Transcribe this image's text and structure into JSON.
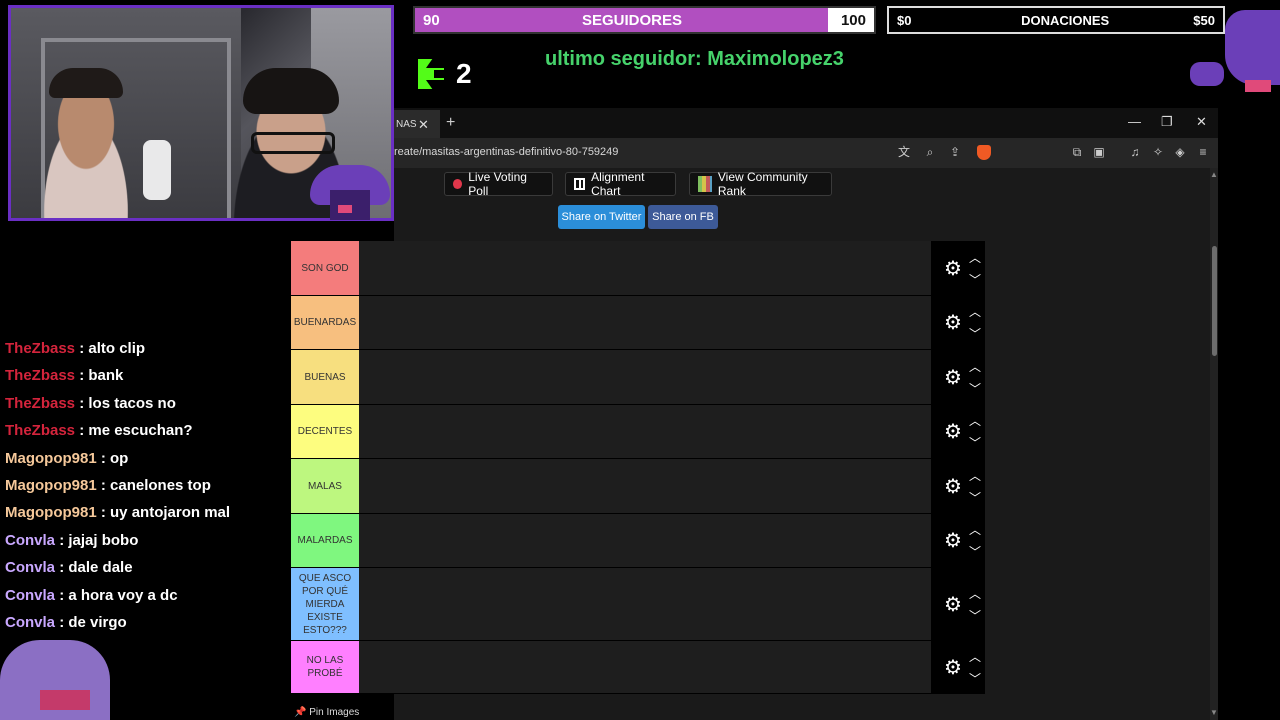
{
  "stream": {
    "followers_bar": {
      "current": "90",
      "label": "SEGUIDORES",
      "goal": "100",
      "fill_pct": 90,
      "fill_color": "#b14fc0"
    },
    "donations_bar": {
      "current": "$0",
      "label": "DONACIONES",
      "goal": "$50"
    },
    "kick": {
      "viewers": "2",
      "logo_color": "#53fc18"
    },
    "last_follower": "ultimo seguidor: Maximolopez3"
  },
  "browser": {
    "tab_title": "NAS",
    "url": "reate/masitas-argentinas-definitivo-80-759249",
    "buttons": {
      "live_voting": "Live Voting Poll",
      "alignment_chart": "Alignment Chart",
      "community_rank": "View Community Rank",
      "share_twitter": "Share on Twitter",
      "share_fb": "Share on FB"
    },
    "pin_images": "Pin Images"
  },
  "tiers": [
    {
      "label": "SON GOD",
      "color": "#f47c7c"
    },
    {
      "label": "BUENARDAS",
      "color": "#f7bf7f"
    },
    {
      "label": "BUENAS",
      "color": "#f7df7f"
    },
    {
      "label": "DECENTES",
      "color": "#fdfd7f"
    },
    {
      "label": "MALAS",
      "color": "#bdf77f"
    },
    {
      "label": "MALARDAS",
      "color": "#7ff77f"
    },
    {
      "label": "QUE ASCO POR QUÉ MIERDA EXISTE ESTO???",
      "color": "#7fbfff"
    },
    {
      "label": "NO LAS PROBÉ",
      "color": "#ff7fff"
    }
  ],
  "chat": [
    {
      "user": "TheZbass",
      "msg": ": alto clip",
      "color": "#d4243c"
    },
    {
      "user": "TheZbass",
      "msg": ": bank",
      "color": "#d4243c"
    },
    {
      "user": "TheZbass",
      "msg": ": los tacos no",
      "color": "#d4243c"
    },
    {
      "user": "TheZbass",
      "msg": ": me escuchan?",
      "color": "#d4243c"
    },
    {
      "user": "Magopop981",
      "msg": ": op",
      "color": "#f5c89a"
    },
    {
      "user": "Magopop981",
      "msg": ": canelones top",
      "color": "#f5c89a"
    },
    {
      "user": "Magopop981",
      "msg": ": uy antojaron mal",
      "color": "#f5c89a"
    },
    {
      "user": "Convla",
      "msg": ": jajaj bobo",
      "color": "#c9a8ff"
    },
    {
      "user": "Convla",
      "msg": ": dale dale",
      "color": "#c9a8ff"
    },
    {
      "user": "Convla",
      "msg": ": a hora voy a dc",
      "color": "#c9a8ff"
    },
    {
      "user": "Convla",
      "msg": ": de virgo",
      "color": "#c9a8ff"
    }
  ]
}
